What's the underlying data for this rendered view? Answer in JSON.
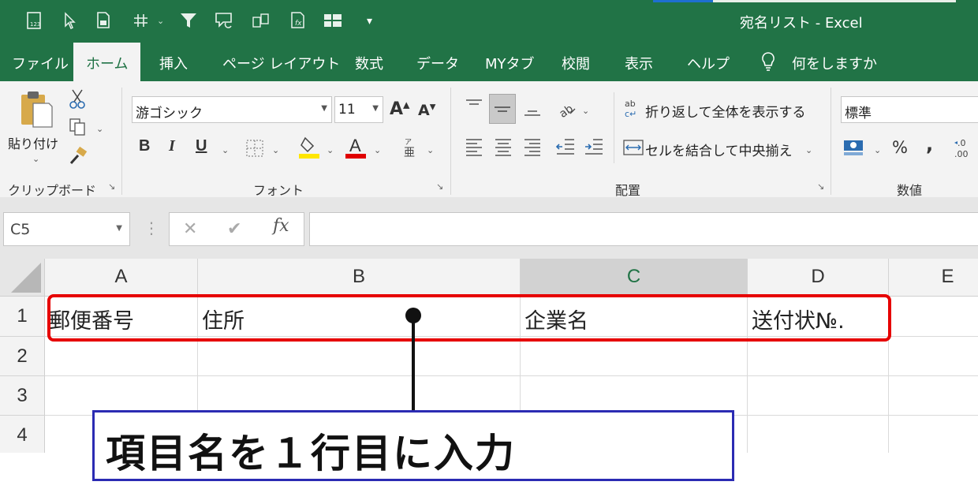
{
  "window": {
    "title": "宛名リスト  -  Excel"
  },
  "quick_access": {
    "icons": [
      "calc-icon",
      "select-objects-icon",
      "print-preview-icon",
      "borders-icon",
      "filter-icon",
      "insert-comment-icon",
      "compare-icon",
      "formula-icon",
      "freeze-panes-icon",
      "customize-qat-icon"
    ]
  },
  "tabs": [
    {
      "label": "ファイル",
      "active": false
    },
    {
      "label": "ホーム",
      "active": true
    },
    {
      "label": "挿入",
      "active": false
    },
    {
      "label": "ページ レイアウト",
      "active": false
    },
    {
      "label": "数式",
      "active": false
    },
    {
      "label": "データ",
      "active": false
    },
    {
      "label": "MYタブ",
      "active": false
    },
    {
      "label": "校閲",
      "active": false
    },
    {
      "label": "表示",
      "active": false
    },
    {
      "label": "ヘルプ",
      "active": false
    }
  ],
  "tell_me": "何をしますか",
  "ribbon": {
    "clipboard": {
      "label": "クリップボード",
      "paste": "貼り付け"
    },
    "font": {
      "label": "フォント",
      "name": "游ゴシック",
      "size": "11",
      "grow": "A",
      "shrink": "A",
      "bold": "B",
      "italic": "I",
      "underline": "U",
      "fill_color": "#ffe600",
      "font_color": "#e00000"
    },
    "alignment": {
      "label": "配置",
      "wrap_text": "折り返して全体を表示する",
      "merge_center": "セルを結合して中央揃え"
    },
    "number": {
      "label": "数値",
      "format": "標準",
      "percent": "%",
      "comma": ","
    }
  },
  "formula_bar": {
    "name_box": "C5",
    "cancel": "✕",
    "enter": "✔",
    "fx": "fx",
    "value": ""
  },
  "sheet": {
    "columns": [
      "A",
      "B",
      "C",
      "D",
      "E"
    ],
    "selected_column": "C",
    "rows": [
      "1",
      "2",
      "3",
      "4"
    ],
    "row1": [
      "郵便番号",
      "住所",
      "企業名",
      "送付状№."
    ]
  },
  "annotation": {
    "callout": "項目名を１行目に入力",
    "highlight_color": "#e60000",
    "callout_border": "#2b2bb3"
  }
}
